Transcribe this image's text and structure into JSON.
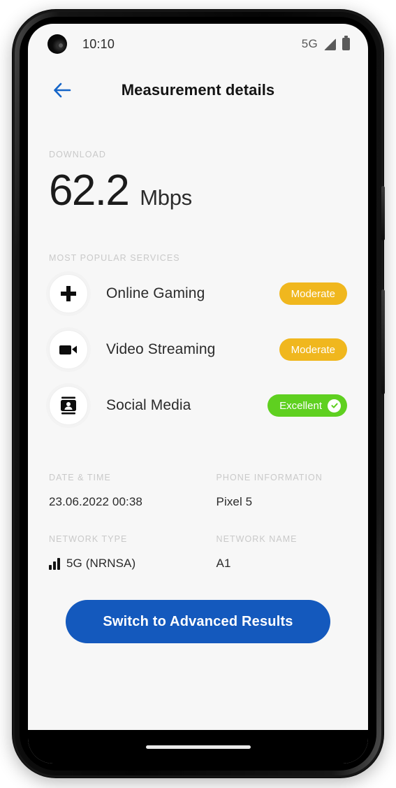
{
  "status_bar": {
    "time": "10:10",
    "network_label": "5G",
    "camera_icon": "camera-punch-hole",
    "signal_icon": "signal-triangle-icon",
    "battery_icon": "battery-icon"
  },
  "app_bar": {
    "back_icon": "back-arrow-icon",
    "title": "Measurement details"
  },
  "download": {
    "label": "DOWNLOAD",
    "value": "62.2",
    "unit": "Mbps"
  },
  "services": {
    "label": "MOST POPULAR SERVICES",
    "items": [
      {
        "name": "Online Gaming",
        "icon": "gamepad-dpad-icon",
        "badge": "Moderate",
        "badge_level": "moderate",
        "badge_color": "#f0b71e",
        "has_check": false
      },
      {
        "name": "Video Streaming",
        "icon": "video-camera-icon",
        "badge": "Moderate",
        "badge_level": "moderate",
        "badge_color": "#f0b71e",
        "has_check": false
      },
      {
        "name": "Social Media",
        "icon": "contact-card-icon",
        "badge": "Excellent",
        "badge_level": "excellent",
        "badge_color": "#5fd020",
        "has_check": true,
        "check_icon": "check-circle-icon"
      }
    ]
  },
  "info": {
    "date_time": {
      "label": "DATE & TIME",
      "value": "23.06.2022 00:38"
    },
    "phone_information": {
      "label": "PHONE INFORMATION",
      "value": "Pixel 5"
    },
    "network_type": {
      "label": "NETWORK TYPE",
      "value": "5G (NRNSA)",
      "icon": "signal-bars-icon"
    },
    "network_name": {
      "label": "NETWORK NAME",
      "value": "A1"
    }
  },
  "cta": {
    "label": "Switch to Advanced Results",
    "color": "#1459bd"
  },
  "system": {
    "gesture_bar": "home-gesture-pill"
  }
}
